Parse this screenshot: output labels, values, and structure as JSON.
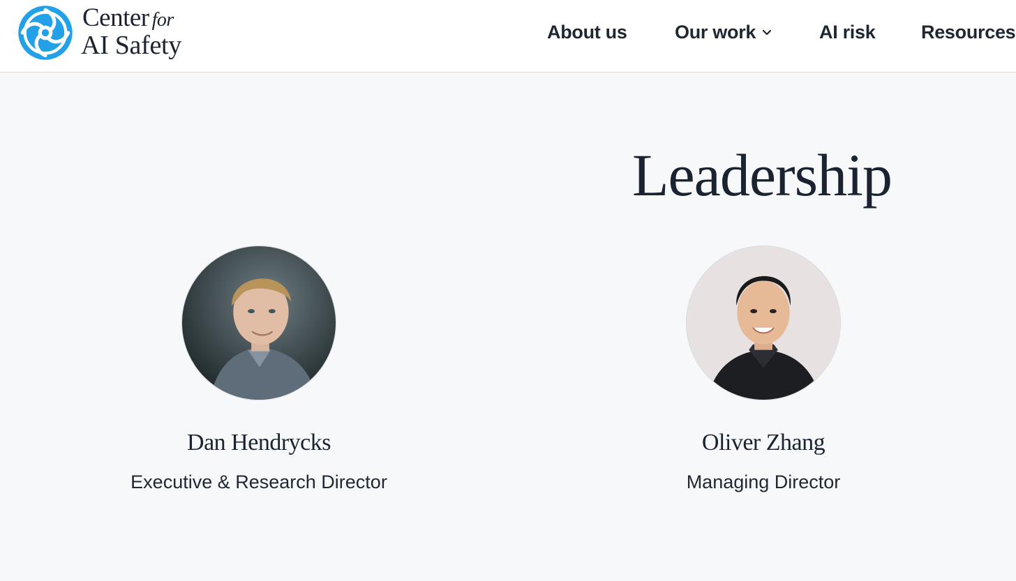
{
  "site": {
    "logo": {
      "line1": "Center",
      "line1_for": "for",
      "line2": "AI Safety",
      "icon": "cais-swirl-logo-icon",
      "brand_color": "#22a0e8"
    }
  },
  "nav": {
    "items": [
      {
        "label": "About us"
      },
      {
        "label": "Our work",
        "icon": "chevron-down-icon"
      },
      {
        "label": "AI risk"
      },
      {
        "label": "Resources"
      }
    ]
  },
  "main": {
    "title": "Leadership",
    "people": [
      {
        "name": "Dan Hendrycks",
        "role": "Executive & Research Director",
        "photo": "portrait-photo"
      },
      {
        "name": "Oliver Zhang",
        "role": "Managing Director",
        "photo": "portrait-photo"
      }
    ]
  },
  "colors": {
    "background": "#f7f8fa",
    "header_background": "#ffffff",
    "text": "#1b2330",
    "accent": "#22a0e8"
  }
}
